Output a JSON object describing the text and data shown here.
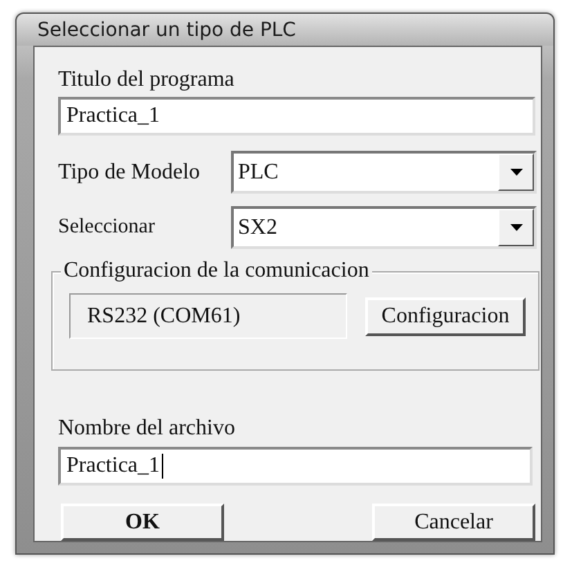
{
  "window": {
    "title": "Seleccionar un tipo de PLC"
  },
  "program_title": {
    "label": "Titulo del programa",
    "value": "Practica_1"
  },
  "model_type": {
    "label": "Tipo de Modelo",
    "value": "PLC"
  },
  "select": {
    "label": "Seleccionar",
    "value": "SX2"
  },
  "communication": {
    "legend": "Configuracion de la comunicacion",
    "port": "RS232 (COM61)",
    "button": "Configuracion"
  },
  "file_name": {
    "label": "Nombre del archivo",
    "value": "Practica_1",
    "focused": true
  },
  "buttons": [
    {
      "label": "OK"
    },
    {
      "label": "Cancelar"
    }
  ]
}
